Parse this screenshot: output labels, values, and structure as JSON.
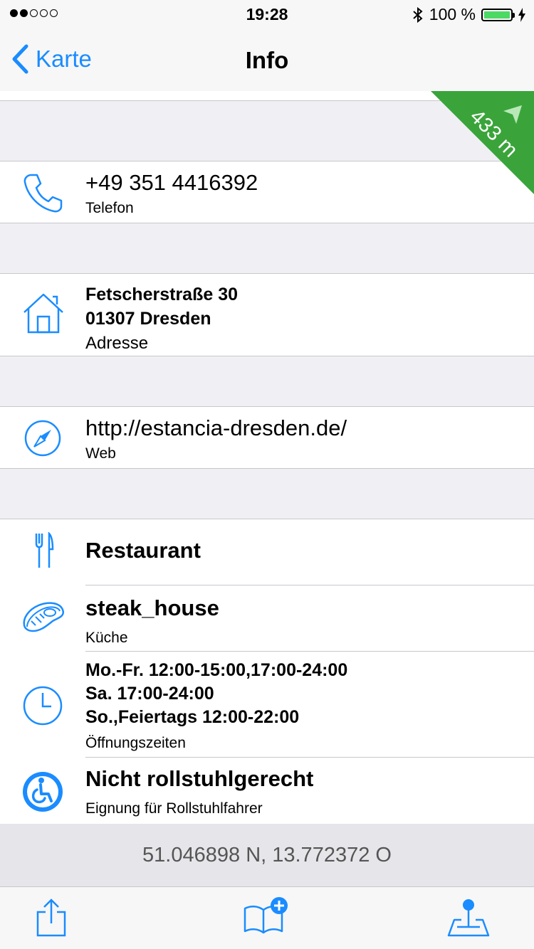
{
  "status_bar": {
    "time": "19:28",
    "battery": "100 %",
    "signal_dots_filled": 2,
    "signal_dots_total": 5
  },
  "nav": {
    "back_label": "Karte",
    "title": "Info"
  },
  "distance": "433 m",
  "phone": {
    "value": "+49 351 4416392",
    "label": "Telefon",
    "icon": "phone-icon"
  },
  "address": {
    "line1": "Fetscherstraße 30",
    "line2": "01307 Dresden",
    "label": "Adresse",
    "icon": "house-icon"
  },
  "web": {
    "value": "http://estancia-dresden.de/",
    "label": "Web",
    "icon": "compass-icon"
  },
  "details": {
    "category": {
      "value": "Restaurant",
      "icon": "fork-knife-icon"
    },
    "cuisine": {
      "value": "steak_house",
      "label": "Küche",
      "icon": "steak-icon"
    },
    "hours": {
      "line1": "Mo.-Fr. 12:00-15:00,17:00-24:00",
      "line2": "Sa. 17:00-24:00",
      "line3": "So.,Feiertags 12:00-22:00",
      "label": "Öffnungszeiten",
      "icon": "clock-icon"
    },
    "wheelchair": {
      "value": "Nicht rollstuhlgerecht",
      "label": "Eignung für Rollstuhlfahrer",
      "icon": "wheelchair-icon"
    }
  },
  "coordinates": "51.046898 N, 13.772372 O",
  "toolbar": {
    "share_icon": "share-icon",
    "bookmark_icon": "bookmark-add-icon",
    "map_pin_icon": "map-pin-icon"
  },
  "colors": {
    "accent": "#1a8cff",
    "distance_badge": "#3aa43a",
    "battery": "#4cd964"
  }
}
